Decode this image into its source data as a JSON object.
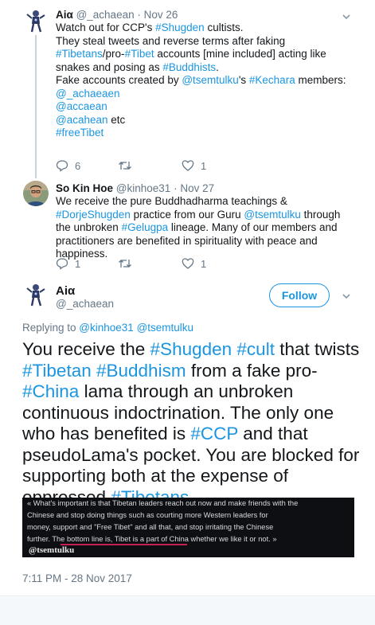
{
  "tweets": [
    {
      "name": "Aiα",
      "handle": "@_achaean",
      "time": "Nov 26",
      "lines": [
        [
          {
            "t": "Watch out for CCP's "
          },
          {
            "t": "#Shugden",
            "c": "hash"
          },
          {
            "t": " cultists."
          }
        ],
        [
          {
            "t": "They steal tweets and reverse terms after faking"
          }
        ],
        [
          {
            "t": "#Tibetans",
            "c": "hash"
          },
          {
            "t": "/pro-"
          },
          {
            "t": "#Tibet",
            "c": "hash"
          },
          {
            "t": " accounts [mine included] acting like"
          }
        ],
        [
          {
            "t": "snakes and posing as "
          },
          {
            "t": "#Buddhists",
            "c": "hash"
          },
          {
            "t": "."
          }
        ],
        [
          {
            "t": " "
          }
        ],
        [
          {
            "t": "Fake accounts created by "
          },
          {
            "t": "@tsemtulku",
            "c": "mention"
          },
          {
            "t": "'s "
          },
          {
            "t": "#Kechara",
            "c": "hash"
          },
          {
            "t": " members:"
          }
        ],
        [
          {
            "t": "@_achaeaen",
            "c": "mention"
          }
        ],
        [
          {
            "t": "@accaean",
            "c": "mention"
          }
        ],
        [
          {
            "t": "@acahean",
            "c": "mention"
          },
          {
            "t": " etc"
          }
        ],
        [
          {
            "t": " "
          }
        ],
        [
          {
            "t": "#freeTibet",
            "c": "hash"
          }
        ]
      ],
      "replies": "6",
      "retweets": "",
      "likes": "1"
    },
    {
      "name": "So Kin Hoe",
      "handle": "@kinhoe31",
      "time": "Nov 27",
      "lines": [
        [
          {
            "t": "We receive the pure Buddhadharma teachings &"
          }
        ],
        [
          {
            "t": "#DorjeShugden",
            "c": "hash"
          },
          {
            "t": " practice from our Guru "
          },
          {
            "t": "@tsemtulku",
            "c": "mention"
          },
          {
            "t": " through"
          }
        ],
        [
          {
            "t": "the unbroken "
          },
          {
            "t": "#Gelugpa",
            "c": "hash"
          },
          {
            "t": " lineage. Many of our members and"
          }
        ],
        [
          {
            "t": "practitioners are benefited in spirituality with peace and"
          }
        ],
        [
          {
            "t": "happiness."
          }
        ]
      ],
      "replies": "1",
      "retweets": "",
      "likes": "1"
    }
  ],
  "focus": {
    "name": "Aiα",
    "handle": "@_achaean",
    "follow_label": "Follow",
    "replying": [
      {
        "t": "Replying to "
      },
      {
        "t": "@kinhoe31",
        "c": "mention"
      },
      {
        "t": " "
      },
      {
        "t": "@tsemtulku",
        "c": "mention"
      }
    ],
    "lines": [
      [
        {
          "t": "You receive the "
        },
        {
          "t": "#Shugden",
          "c": "hash"
        },
        {
          "t": " "
        },
        {
          "t": "#cult",
          "c": "hash"
        },
        {
          "t": " that twists"
        }
      ],
      [
        {
          "t": "#Tibetan",
          "c": "hash"
        },
        {
          "t": " "
        },
        {
          "t": "#Buddhism",
          "c": "hash"
        },
        {
          "t": " from a fake pro-"
        }
      ],
      [
        {
          "t": "#China",
          "c": "hash"
        },
        {
          "t": " lama through an unbroken"
        }
      ],
      [
        {
          "t": "continuous indoctrination. The only one"
        }
      ],
      [
        {
          "t": "who has benefited is "
        },
        {
          "t": "#CCP",
          "c": "hash"
        },
        {
          "t": " and that"
        }
      ],
      [
        {
          "t": "pseudoLama's pocket. You are blocked for"
        }
      ],
      [
        {
          "t": "supporting both at the expense of"
        }
      ],
      [
        {
          "t": "oppressed "
        },
        {
          "t": "#Tibetans",
          "c": "hash"
        },
        {
          "t": "."
        }
      ]
    ],
    "quote_lines": [
      "« What's important is that Tibetan leaders reach out now and make friends with the",
      "Chinese and stop doing things such as courting more Western leaders for",
      "money, support and \"Free Tibet\" and all that, and stop irritating the Chinese",
      "further. The bottom line is, Tibet is a part of China whether we like it or not. »"
    ],
    "quote_signature": "@tsemtulku",
    "timestamp": "7:11 PM - 28 Nov 2017"
  },
  "colors": {
    "link": "#1b95e0",
    "meta": "#657786",
    "underline": "#e0245e"
  },
  "icons": [
    "robot-avatar",
    "person-avatar",
    "chevron-down-icon",
    "reply-icon",
    "retweet-icon",
    "like-icon"
  ]
}
